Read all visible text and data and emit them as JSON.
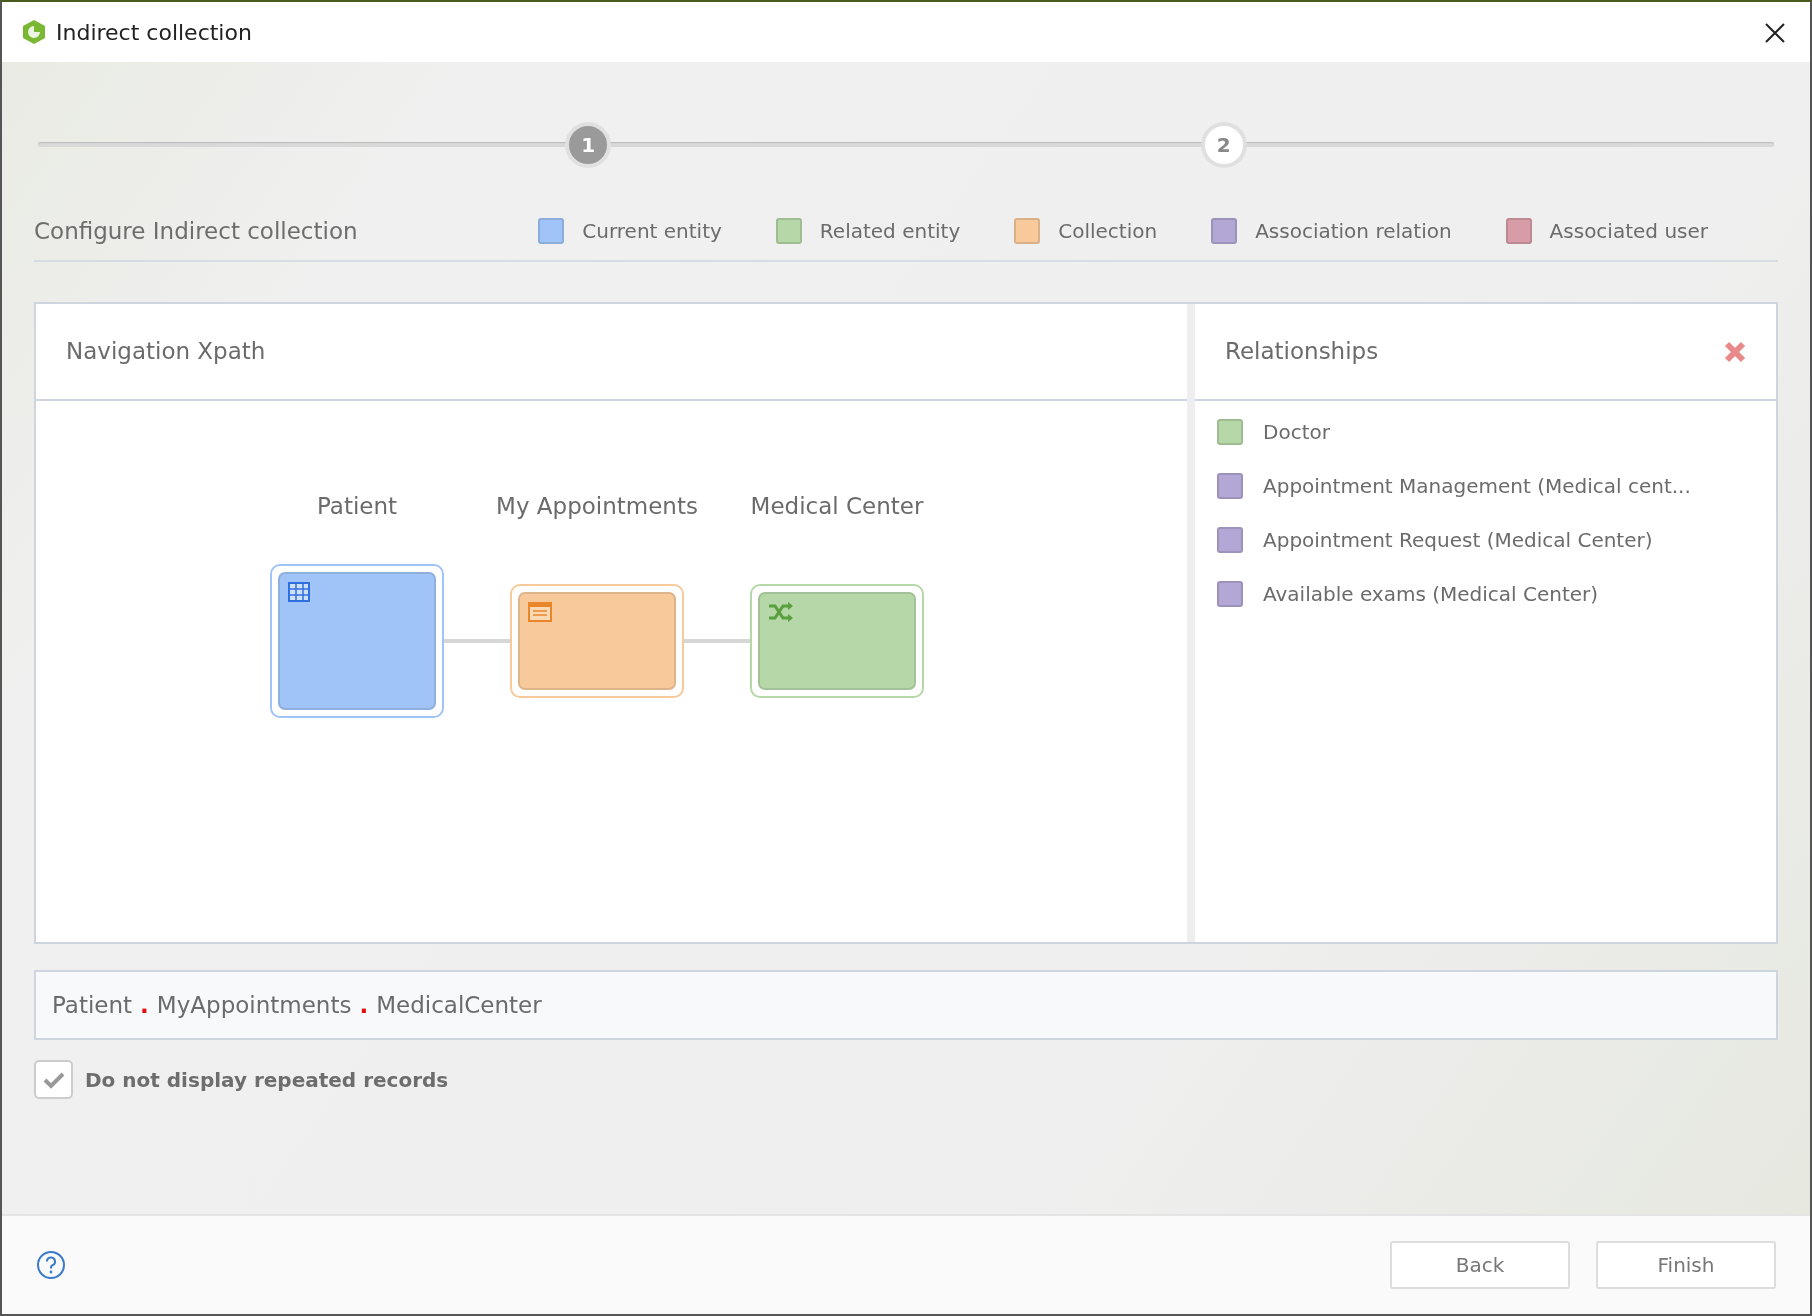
{
  "window": {
    "title": "Indirect collection"
  },
  "steps": [
    {
      "label": "1",
      "selected": false
    },
    {
      "label": "2",
      "selected": true
    }
  ],
  "heading": "Configure Indirect collection",
  "legend": [
    {
      "label": "Current entity",
      "color": "#a0c4f8"
    },
    {
      "label": "Related entity",
      "color": "#b6d7a8"
    },
    {
      "label": "Collection",
      "color": "#f8c99a"
    },
    {
      "label": "Association relation",
      "color": "#b3a7d6"
    },
    {
      "label": "Associated user",
      "color": "#d89ca8"
    }
  ],
  "navigation": {
    "title": "Navigation Xpath",
    "nodes": [
      {
        "label": "Patient",
        "kind": "table",
        "color": "#a0c4f8"
      },
      {
        "label": "My Appointments",
        "kind": "list",
        "color": "#f8c99a"
      },
      {
        "label": "Medical Center",
        "kind": "shuffle",
        "color": "#b6d7a8"
      }
    ]
  },
  "relationships": {
    "title": "Relationships",
    "items": [
      {
        "label": "Doctor",
        "color": "#b6d7a8"
      },
      {
        "label": "Appointment Management (Medical cent...",
        "color": "#b3a7d6"
      },
      {
        "label": "Appointment Request (Medical Center)",
        "color": "#b3a7d6"
      },
      {
        "label": "Available exams (Medical Center)",
        "color": "#b3a7d6"
      }
    ]
  },
  "path": {
    "segments": [
      "Patient",
      "MyAppointments",
      "MedicalCenter"
    ],
    "separator": "."
  },
  "option": {
    "label": "Do not display repeated records",
    "checked": true
  },
  "buttons": [
    "Back",
    "Finish"
  ]
}
